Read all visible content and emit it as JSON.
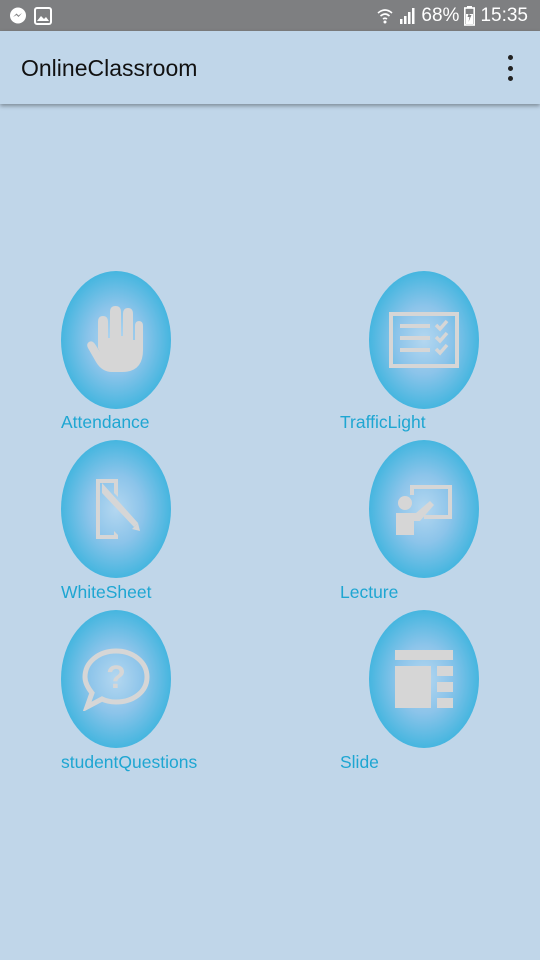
{
  "status_bar": {
    "battery": "68%",
    "time": "15:35",
    "icons": [
      "messenger-icon",
      "gallery-icon",
      "wifi-icon",
      "signal-icon",
      "battery-icon"
    ]
  },
  "app_bar": {
    "title": "OnlineClassroom",
    "menu_icon": "more-vert-icon"
  },
  "tiles": [
    {
      "label": "Attendance",
      "icon": "hand-icon"
    },
    {
      "label": "TrafficLight",
      "icon": "checklist-icon"
    },
    {
      "label": "WhiteSheet",
      "icon": "door-sheet-icon"
    },
    {
      "label": "Lecture",
      "icon": "presenter-icon"
    },
    {
      "label": "studentQuestions",
      "icon": "question-bubble-icon"
    },
    {
      "label": "Slide",
      "icon": "slide-layout-icon"
    }
  ],
  "colors": {
    "background": "#c0d6e9",
    "status_bar": "#7e7f81",
    "accent": "#1ea6d2",
    "icon_fill": "#d6d6d6"
  }
}
